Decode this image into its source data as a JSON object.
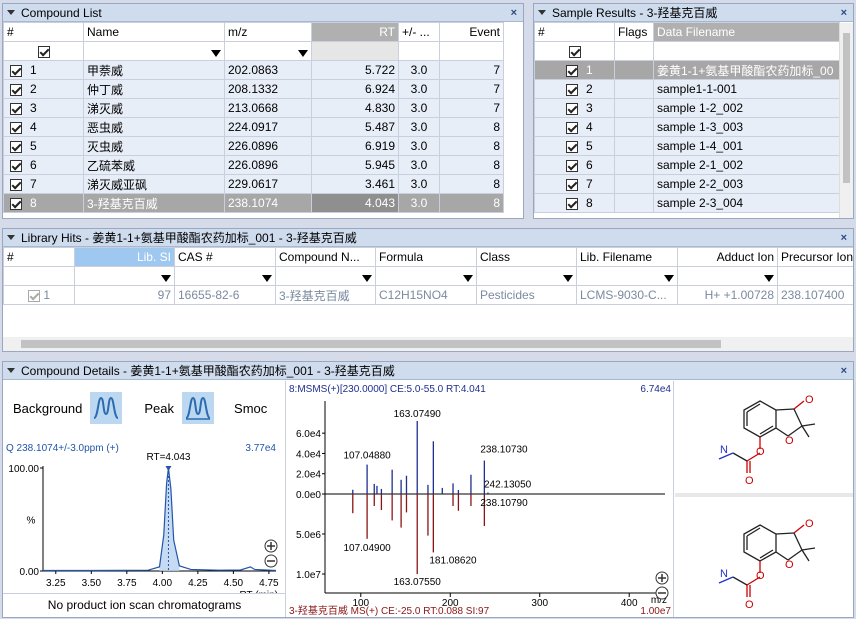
{
  "compound_list": {
    "title": "Compound List",
    "headers": [
      "#",
      "Name",
      "m/z",
      "RT",
      "+/- ...",
      "Event"
    ],
    "rows": [
      {
        "n": "1",
        "name": "甲萘威",
        "mz": "202.0863",
        "rt": "5.722",
        "tol": "3.0",
        "event": "7"
      },
      {
        "n": "2",
        "name": "仲丁威",
        "mz": "208.1332",
        "rt": "6.924",
        "tol": "3.0",
        "event": "7"
      },
      {
        "n": "3",
        "name": "涕灭威",
        "mz": "213.0668",
        "rt": "4.830",
        "tol": "3.0",
        "event": "7"
      },
      {
        "n": "4",
        "name": "恶虫威",
        "mz": "224.0917",
        "rt": "5.487",
        "tol": "3.0",
        "event": "8"
      },
      {
        "n": "5",
        "name": "灭虫威",
        "mz": "226.0896",
        "rt": "6.919",
        "tol": "3.0",
        "event": "8"
      },
      {
        "n": "6",
        "name": "乙硫苯威",
        "mz": "226.0896",
        "rt": "5.945",
        "tol": "3.0",
        "event": "8"
      },
      {
        "n": "7",
        "name": "涕灭威亚砜",
        "mz": "229.0617",
        "rt": "3.461",
        "tol": "3.0",
        "event": "8"
      },
      {
        "n": "8",
        "name": "3-羟基克百威",
        "mz": "238.1074",
        "rt": "4.043",
        "tol": "3.0",
        "event": "8"
      }
    ]
  },
  "sample_results": {
    "title": "Sample Results - 3-羟基克百威",
    "headers": [
      "#",
      "Flags",
      "Data Filename"
    ],
    "rows": [
      {
        "n": "1",
        "file": "姜黄1-1+氨基甲酸酯农药加标_00"
      },
      {
        "n": "2",
        "file": "sample1-1-001"
      },
      {
        "n": "3",
        "file": "sample 1-2_002"
      },
      {
        "n": "4",
        "file": "sample 1-3_003"
      },
      {
        "n": "5",
        "file": "sample 1-4_001"
      },
      {
        "n": "6",
        "file": "sample 2-1_002"
      },
      {
        "n": "7",
        "file": "sample 2-2_003"
      },
      {
        "n": "8",
        "file": "sample 2-3_004"
      }
    ]
  },
  "library_hits": {
    "title": "Library Hits - 姜黄1-1+氨基甲酸酯农药加标_001 - 3-羟基克百威",
    "headers": [
      "#",
      "Lib. SI",
      "CAS #",
      "Compound N...",
      "Formula",
      "Class",
      "Lib. Filename",
      "Adduct Ion",
      "Precursor Ion"
    ],
    "row": {
      "n": "1",
      "si": "97",
      "cas": "16655-82-6",
      "compound": "3-羟基克百威",
      "formula": "C12H15NO4",
      "class": "Pesticides",
      "file": "LCMS-9030-C...",
      "adduct": "H+ +1.00728",
      "precursor": "238.107400"
    }
  },
  "compound_details": {
    "title": "Compound Details - 姜黄1-1+氨基甲酸酯农药加标_001 - 3-羟基克百威",
    "background_label": "Background",
    "peak_label": "Peak",
    "smooth_label": "Smoc",
    "no_product": "No product ion scan chromatograms"
  },
  "chart_data": [
    {
      "type": "line",
      "title": "Q 238.1074+/-3.0ppm (+)",
      "max_label": "3.77e4",
      "annotation": "RT=4.043",
      "xlabel": "RT (min)",
      "ylabel": "%",
      "x_ticks": [
        "3.25",
        "3.50",
        "3.75",
        "4.00",
        "4.25",
        "4.50",
        "4.75"
      ],
      "y_ticks": [
        "0.00",
        "100.00"
      ],
      "xlim": [
        3.16,
        4.8
      ],
      "ylim": [
        0,
        100
      ],
      "x": [
        3.16,
        3.3,
        3.5,
        3.7,
        3.9,
        3.98,
        4.01,
        4.03,
        4.043,
        4.06,
        4.08,
        4.12,
        4.2,
        4.4,
        4.55,
        4.62,
        4.65,
        4.8
      ],
      "y": [
        0.5,
        0.5,
        0.5,
        0.6,
        0.8,
        4,
        35,
        85,
        100,
        80,
        30,
        5,
        1.5,
        0.8,
        1,
        4,
        1.5,
        0.5
      ]
    },
    {
      "type": "bar",
      "title": "8:MSMS(+)[230.0000] CE:5.0-55.0 RT:4.041",
      "max_label": "6.74e4",
      "bottom_title": "3-羟基克百威 MS(+) CE:-25.0 RT:0.088 SI:97",
      "bottom_max_label": "1.00e7",
      "xlabel": "m/z",
      "x_ticks": [
        "100",
        "200",
        "300",
        "400"
      ],
      "y_ticks_top": [
        "0.0e0",
        "2.0e4",
        "4.0e4",
        "6.0e4"
      ],
      "y_ticks_bottom": [
        "5.0e6",
        "1.0e7"
      ],
      "xlim": [
        60,
        440
      ],
      "series": [
        {
          "name": "measured",
          "x": [
            91.05,
            107.0488,
            115.05,
            118.07,
            123.04,
            135.04,
            145.06,
            151.07,
            163.0749,
            175.07,
            181.0862,
            191.1,
            203.09,
            209.1,
            223.12,
            238.1073,
            242.1305
          ],
          "y": [
            4200,
            29000,
            10000,
            8000,
            5000,
            24000,
            14000,
            18000,
            72000,
            9000,
            52000,
            6000,
            10500,
            4000,
            19000,
            33000,
            1500
          ]
        },
        {
          "name": "library",
          "x": [
            91.05,
            107.049,
            115.05,
            123.04,
            135.04,
            145.06,
            151.07,
            163.0755,
            175.07,
            181.0862,
            203.09,
            209.1,
            223.12,
            238.1079
          ],
          "y": [
            2400000,
            5600000,
            1500000,
            2000000,
            3300000,
            4200000,
            2300000,
            10000000,
            5200000,
            7300000,
            1500000,
            2100000,
            1500000,
            4000000
          ]
        }
      ],
      "labels": [
        "163.07490",
        "107.04880",
        "238.10730",
        "242.13050",
        "238.10790",
        "107.04900",
        "181.08620",
        "163.07550"
      ]
    }
  ],
  "colors": {
    "measured": "#1e2f8f",
    "library": "#8b1515",
    "chromatogram": "#2255aa",
    "accent": "#9ec8ef"
  }
}
